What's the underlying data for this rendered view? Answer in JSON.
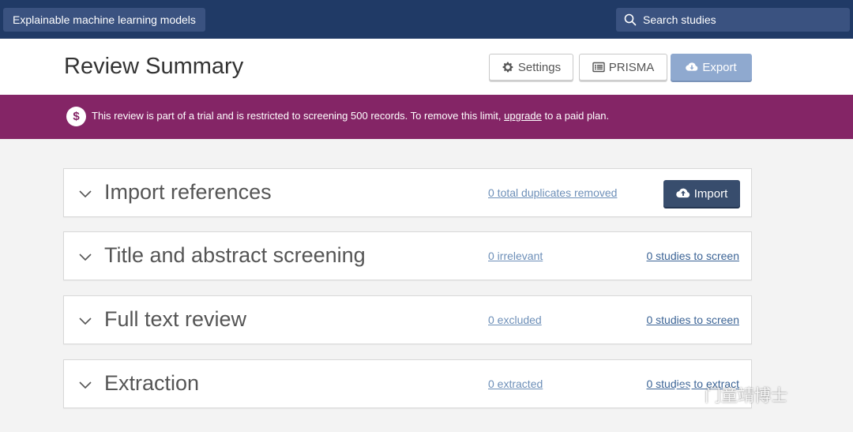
{
  "topbar": {
    "project_name": "Explainable machine learning models",
    "search_placeholder": "Search studies"
  },
  "header": {
    "title": "Review Summary",
    "settings_label": "Settings",
    "prisma_label": "PRISMA",
    "export_label": "Export"
  },
  "banner": {
    "text_before": "This review is part of a trial and is restricted to screening 500 records. To remove this limit, ",
    "link_text": "upgrade",
    "text_after": " to a paid plan.",
    "color": "#842566"
  },
  "stages": [
    {
      "title": "Import references",
      "link1": "0 total duplicates removed",
      "button": "Import"
    },
    {
      "title": "Title and abstract screening",
      "link1": "0 irrelevant",
      "link2": "0 studies to screen"
    },
    {
      "title": "Full text review",
      "link1": "0 excluded",
      "link2": "0 studies to screen"
    },
    {
      "title": "Extraction",
      "link1": "0 extracted",
      "link2": "0 studies to extract"
    }
  ],
  "watermark": {
    "text": "门童靖博士"
  },
  "colors": {
    "topbar": "#203a66",
    "accent": "#8fa9cf",
    "import_button": "#384d6d"
  }
}
